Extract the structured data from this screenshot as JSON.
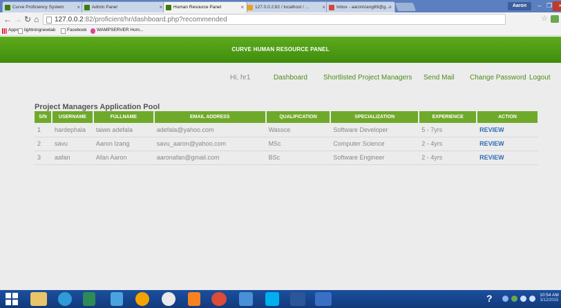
{
  "browser": {
    "tabs": [
      {
        "label": "Curve Proficiency System",
        "color": "#3a7d0c"
      },
      {
        "label": "Admin Panel",
        "color": "#3a7d0c"
      },
      {
        "label": "Human Resource Panel",
        "color": "#3a7d0c",
        "active": true
      },
      {
        "label": "127.0.0.2:82 / localhost / ...",
        "color": "#e8a317"
      },
      {
        "label": "Inbox - aaronizang89@g... ",
        "color": "#d44638"
      }
    ],
    "user": "Aaron",
    "url_host": "127.0.0.2",
    "url_path": ":82/proficient/hr/dashboard.php?recommended",
    "bookmarks": [
      {
        "label": "Apps",
        "icon": "apps-grid-icon"
      },
      {
        "label": "lightningnewtab",
        "icon": "page-icon"
      },
      {
        "label": "Facebook",
        "icon": "page-icon"
      },
      {
        "label": "WAMPSERVER Hom...",
        "icon": "wamp-icon"
      }
    ]
  },
  "header": {
    "title": "CURVE HUMAN RESOURCE PANEL"
  },
  "nav": {
    "greeting": "Hi, hr1",
    "links": [
      "Dashboard",
      "Shortlisted Project Managers",
      "Send Mail",
      "Change Password",
      "Logout"
    ]
  },
  "pool": {
    "title": "Project Managers Application Pool",
    "columns": [
      "S/N",
      "USERNAME",
      "FULLNAME",
      "EMAIL ADDRESS",
      "QUALIFICATION",
      "SPECIALIZATION",
      "EXPERIENCE",
      "ACTION"
    ],
    "rows": [
      [
        "1",
        "hardephala",
        "taiwo adefala",
        "adefala@yahoo.com",
        "Wassce",
        "Software Developer",
        "5 - 7yrs",
        "REVIEW"
      ],
      [
        "2",
        "savu",
        "Aaron Izang",
        "savu_aaron@yahoo.com",
        "MSc",
        "Computer Science",
        "2 - 4yrs",
        "REVIEW"
      ],
      [
        "3",
        "aafan",
        "Afan Aaron",
        "aaronafan@gmail.com",
        "BSc",
        "Software Engineer",
        "2 - 4yrs",
        "REVIEW"
      ]
    ]
  },
  "taskbar": {
    "time": "10:54 AM",
    "date": "3/12/2015"
  },
  "colors": {
    "brand_green": "#5eab1e",
    "link_green": "#4a8c1a",
    "action_blue": "#2e6db4"
  }
}
